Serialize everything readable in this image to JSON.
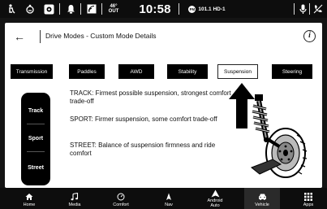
{
  "status_bar": {
    "temperature": "46°",
    "temperature_label": "OUT",
    "time": "10:58",
    "radio_band": "FM",
    "radio_station": "101.1 HD-1",
    "icons": [
      "seatbelt-icon",
      "driver-attention-icon",
      "camera-icon",
      "notification-bell-icon",
      "wifi-hotspot-icon",
      "microphone-icon",
      "phone-off-icon"
    ]
  },
  "header": {
    "back_icon": "←",
    "title": "Drive Modes - Custom Mode Details",
    "info_icon": "i"
  },
  "tabs": [
    {
      "label": "Transmission",
      "selected": false
    },
    {
      "label": "Paddles",
      "selected": false
    },
    {
      "label": "AWD",
      "selected": false
    },
    {
      "label": "Stability",
      "selected": false
    },
    {
      "label": "Suspension",
      "selected": true
    },
    {
      "label": "Steering",
      "selected": false
    }
  ],
  "modes": [
    {
      "label": "Track",
      "description": "TRACK: Firmest possible suspension, strongest comfort trade-off"
    },
    {
      "label": "Sport",
      "description": "SPORT: Firmer suspension, some comfort trade-off"
    },
    {
      "label": "Street",
      "description": "STREET: Balance of suspension firmness and ride comfort"
    }
  ],
  "nav": {
    "selected": "Vehicle",
    "items": [
      {
        "label": "Home",
        "icon": "home-icon"
      },
      {
        "label": "Media",
        "icon": "music-note-icon"
      },
      {
        "label": "Comfort",
        "icon": "comfort-dial-icon"
      },
      {
        "label": "Nav",
        "icon": "navigation-arrow-icon"
      },
      {
        "label": "Android Auto",
        "icon": "android-auto-icon"
      },
      {
        "label": "Vehicle",
        "icon": "car-icon"
      },
      {
        "label": "Apps",
        "icon": "apps-grid-icon"
      }
    ]
  },
  "colors": {
    "panel_bg": "#ffffff",
    "bar_bg": "#0d0d0d",
    "tab_bg": "#000000",
    "active_nav_bg": "#2a2a2a"
  }
}
